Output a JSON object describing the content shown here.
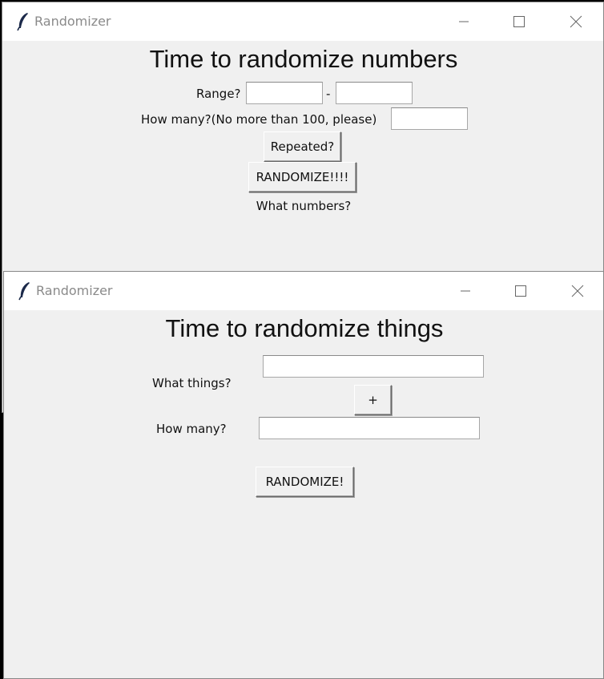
{
  "window1": {
    "title": "Randomizer",
    "heading": "Time to randomize numbers",
    "range_label": "Range?",
    "range_separator": "-",
    "range_min_value": "",
    "range_max_value": "",
    "how_many_label": "How many?(No more than 100, please)",
    "how_many_value": "",
    "repeated_button": "Repeated?",
    "randomize_button": "RANDOMIZE!!!!",
    "result_label": "What numbers?"
  },
  "window2": {
    "title": "Randomizer",
    "heading": "Time to randomize things",
    "things_label": "What things?",
    "things_value": "",
    "add_button": "+",
    "how_many_label": "How many?",
    "how_many_value": "",
    "randomize_button": "RANDOMIZE!"
  },
  "icons": {
    "app": "feather-icon",
    "minimize": "minimize-icon",
    "maximize": "maximize-icon",
    "close": "close-icon"
  },
  "colors": {
    "window_bg": "#f0f0f0",
    "titlebar_bg": "#ffffff",
    "title_text": "#8a8a8a",
    "desktop_bg": "#000000"
  }
}
